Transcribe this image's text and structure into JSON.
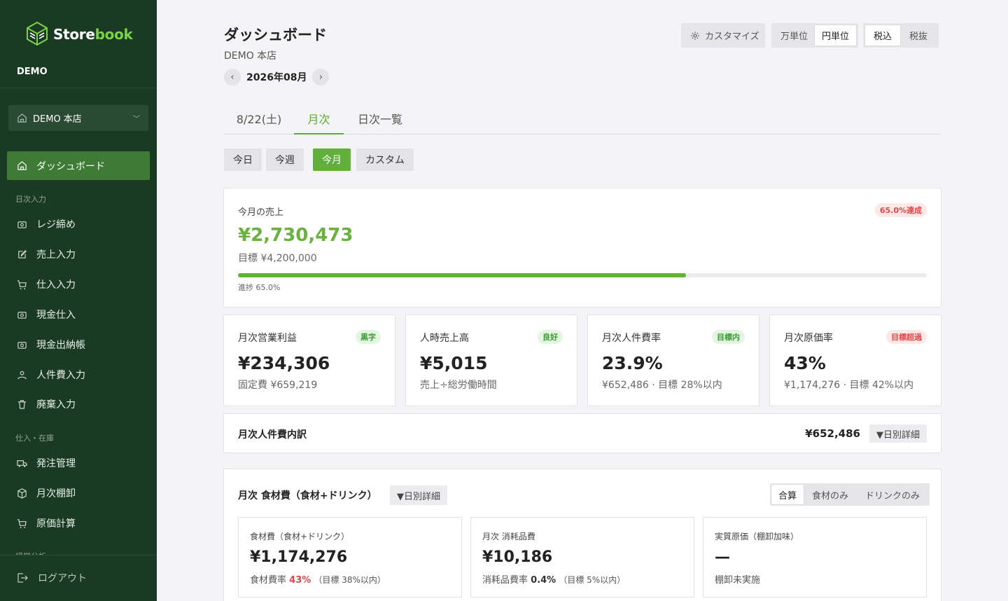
{
  "sidebar": {
    "brand_prefix": "Store",
    "brand_suffix": "book",
    "org": "DEMO",
    "store": "DEMO 本店",
    "active_item": "ダッシュボード",
    "sections": [
      "日次入力",
      "仕入・在庫",
      "経営分析"
    ],
    "items_daily": [
      "レジ締め",
      "売上入力",
      "仕入入力",
      "現金仕入",
      "現金出納帳",
      "人件費入力",
      "廃棄入力"
    ],
    "items_stock": [
      "発注管理",
      "月次棚卸",
      "原価計算"
    ],
    "logout": "ログアウト",
    "colors": {
      "bg": "#1a3a24",
      "active": "#3e7b35",
      "accent": "#7cd34a"
    }
  },
  "header": {
    "title": "ダッシュボード",
    "store": "DEMO 本店",
    "month": "2026年08月",
    "prev": "‹",
    "next": "›",
    "customize": "カスタマイズ",
    "unit_options": [
      "万単位",
      "円単位"
    ],
    "unit_selected": "円単位",
    "tax_options": [
      "税込",
      "税抜"
    ],
    "tax_selected": "税込"
  },
  "tabs": [
    "8/22(土)",
    "月次",
    "日次一覧"
  ],
  "active_tab": "月次",
  "filters": [
    "今日",
    "今週",
    "今月",
    "カスタム"
  ],
  "active_filter": "今月",
  "sales": {
    "label": "今月の売上",
    "badge": "65.0%達成",
    "value": "¥2,730,473",
    "target": "目標 ¥4,200,000",
    "progress": 0.65,
    "progress_label": "進捗 65.0%"
  },
  "kpis": [
    {
      "title": "月次営業利益",
      "badge": "黒字",
      "badge_tone": "green",
      "value": "¥234,306",
      "sub": "固定費 ¥659,219"
    },
    {
      "title": "人時売上高",
      "badge": "良好",
      "badge_tone": "green",
      "value": "¥5,015",
      "sub": "売上÷総労働時間"
    },
    {
      "title": "月次人件費率",
      "badge": "目標内",
      "badge_tone": "green",
      "value": "23.9%",
      "sub": "¥652,486 · 目標 28%以内"
    },
    {
      "title": "月次原価率",
      "badge": "目標超過",
      "badge_tone": "red",
      "value": "43%",
      "sub": "¥1,174,276 · 目標 42%以内"
    }
  ],
  "labor": {
    "title": "月次人件費内訳",
    "value": "¥652,486",
    "detail": "▼日別詳細"
  },
  "food": {
    "title": "月次 食材費（食材+ドリンク）",
    "detail": "▼日別詳細",
    "toggle": [
      "合算",
      "食材のみ",
      "ドリンクのみ"
    ],
    "toggle_selected": "合算",
    "cards": [
      {
        "title": "食材費（食材+ドリンク）",
        "value": "¥1,174,276",
        "note_prefix": "食材費率",
        "note_value": "43%",
        "note_suffix": "（目標 38%以内）"
      },
      {
        "title": "月次 消耗品費",
        "value": "¥10,186",
        "note_prefix": "消耗品費率",
        "note_value": "0.4%",
        "note_suffix": "（目標 5%以内）"
      },
      {
        "title": "実質原価（棚卸加味）",
        "value": "—",
        "note_prefix": "棚卸未実施",
        "note_value": "",
        "note_suffix": ""
      }
    ]
  }
}
